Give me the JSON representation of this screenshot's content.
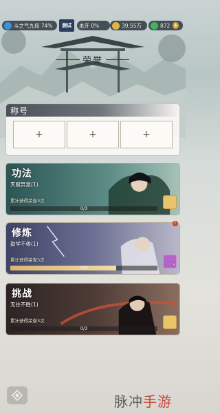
{
  "topbar": {
    "power": "斗之气九段 74%",
    "test_badge": "测试",
    "unopened": "未开 0%",
    "coins": "39.55万",
    "gems": "872"
  },
  "page_title": "荣誉",
  "titles_section": {
    "heading": "称号",
    "slots": [
      "+",
      "+",
      "+"
    ]
  },
  "features": [
    {
      "title": "功法",
      "achievement": "天赋异禀(1)",
      "subtitle": "累计获得荣誉3次",
      "progress_text": "0/3",
      "progress": 0.0,
      "reward_qty": "",
      "accent": "#2f6f6e"
    },
    {
      "title": "修炼",
      "achievement": "勤学不倦(1)",
      "subtitle": "累计获得荣誉3次",
      "progress_text": "0/3",
      "progress": 0.72,
      "reward_qty": "5",
      "accent": "#4c4f7a",
      "has_badge": true,
      "badge": "!"
    },
    {
      "title": "挑战",
      "achievement": "无往不胜(1)",
      "subtitle": "累计获得荣誉3次",
      "progress_text": "0/3",
      "progress": 0.0,
      "reward_qty": "",
      "accent": "#3b2a2a"
    }
  ],
  "watermark": {
    "part1": "脉冲",
    "part2": "手游网"
  },
  "colors": {
    "gold": "#d4a23d",
    "panel": "#fbfaf7"
  }
}
